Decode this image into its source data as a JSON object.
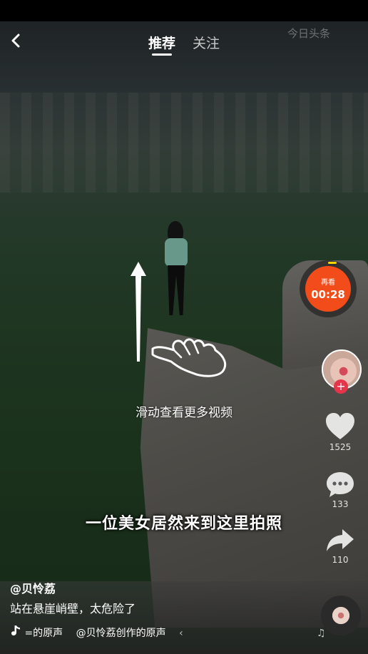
{
  "topbar": {
    "tabs": [
      {
        "label": "推荐",
        "active": true
      },
      {
        "label": "关注",
        "active": false
      }
    ],
    "watermark": "今日头条"
  },
  "video": {
    "subtitle": "一位美女居然来到这里拍照",
    "swipe_hint": "滑动查看更多视频"
  },
  "timer": {
    "label": "再看",
    "time": "00:28",
    "accent": "#f24c1a"
  },
  "actions": {
    "like_count": "1525",
    "comment_count": "133",
    "share_count": "110"
  },
  "post": {
    "author": "@贝怜荔",
    "description": "站在悬崖峭壁，太危险了",
    "music_text_1": "=的原声",
    "music_text_2": "@贝怜荔创作的原声",
    "music_trail": "‹"
  },
  "icons": [
    "back-icon",
    "tiktok-note-icon",
    "heart-icon",
    "comment-icon",
    "share-icon",
    "hand-icon",
    "swipe-arrow-icon",
    "music-note-icon"
  ]
}
